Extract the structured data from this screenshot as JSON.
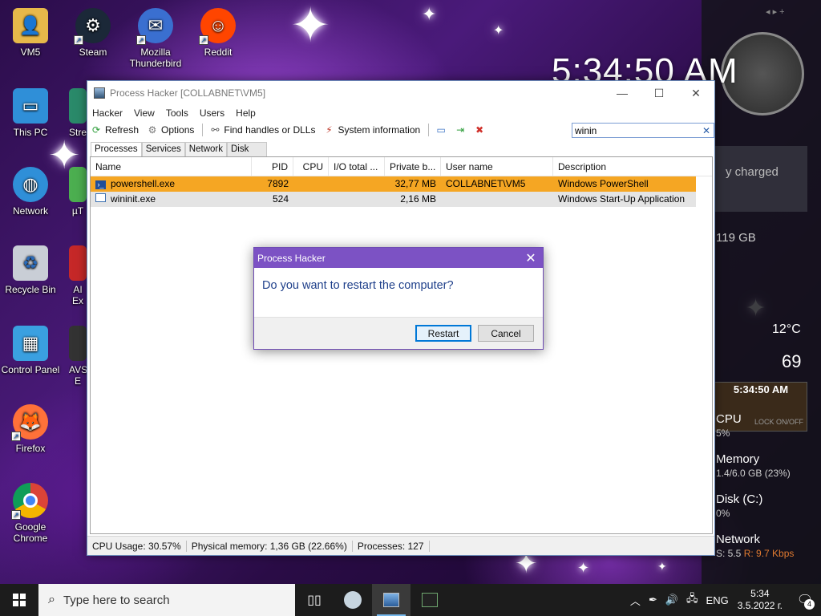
{
  "desktop": {
    "icons": [
      {
        "label": "VM5"
      },
      {
        "label": "Steam"
      },
      {
        "label": "Mozilla Thunderbird"
      },
      {
        "label": "Reddit"
      },
      {
        "label": "This PC"
      },
      {
        "label": "Network"
      },
      {
        "label": "Recycle Bin"
      },
      {
        "label": "Control Panel"
      },
      {
        "label": "Firefox"
      },
      {
        "label": "Google Chrome"
      }
    ],
    "partial_labels": [
      "Stre",
      "µT",
      "AI Ex",
      "AVS E"
    ]
  },
  "widgets": {
    "big_clock": "5:34:50 AM",
    "battery_text": "y charged",
    "disk_free": "119 GB",
    "temperature": "12°C",
    "humidity": "69",
    "digital_clock": "5:34:50 AM",
    "lock_label": "LOCK ON/OFF",
    "cpu_label": "CPU",
    "cpu_value": "5%",
    "memory_label": "Memory",
    "memory_value": "1.4/6.0 GB (23%)",
    "disk_label": "Disk (C:)",
    "disk_value": "0%",
    "network_label": "Network",
    "network_s": "S: 5.5",
    "network_r": "R: 9.7 Kbps"
  },
  "ph": {
    "title": "Process Hacker [COLLABNET\\VM5]",
    "menu": [
      "Hacker",
      "View",
      "Tools",
      "Users",
      "Help"
    ],
    "toolbar": {
      "refresh": "Refresh",
      "options": "Options",
      "find_handles": "Find handles or DLLs",
      "system_info": "System information"
    },
    "search_value": "winin",
    "tabs": [
      "Processes",
      "Services",
      "Network",
      "Disk"
    ],
    "columns": [
      "Name",
      "PID",
      "CPU",
      "I/O total ...",
      "Private b...",
      "User name",
      "Description"
    ],
    "rows": [
      {
        "name": "powershell.exe",
        "pid": "7892",
        "cpu": "",
        "io": "",
        "private": "32,77 MB",
        "user": "COLLABNET\\VM5",
        "desc": "Windows PowerShell"
      },
      {
        "name": "wininit.exe",
        "pid": "524",
        "cpu": "",
        "io": "",
        "private": "2,16 MB",
        "user": "",
        "desc": "Windows Start-Up Application"
      }
    ],
    "status": {
      "cpu": "CPU Usage: 30.57%",
      "memory": "Physical memory: 1,36 GB (22.66%)",
      "processes": "Processes: 127"
    }
  },
  "dialog": {
    "title": "Process Hacker",
    "message": "Do you want to restart the computer?",
    "restart": "Restart",
    "cancel": "Cancel"
  },
  "taskbar": {
    "search_placeholder": "Type here to search",
    "language": "ENG",
    "time": "5:34",
    "date": "3.5.2022 г.",
    "notifications": "4"
  },
  "colors": {
    "selection": "#f5a623",
    "dialog_title": "#7c52c4",
    "dialog_text": "#1e3f8a"
  }
}
